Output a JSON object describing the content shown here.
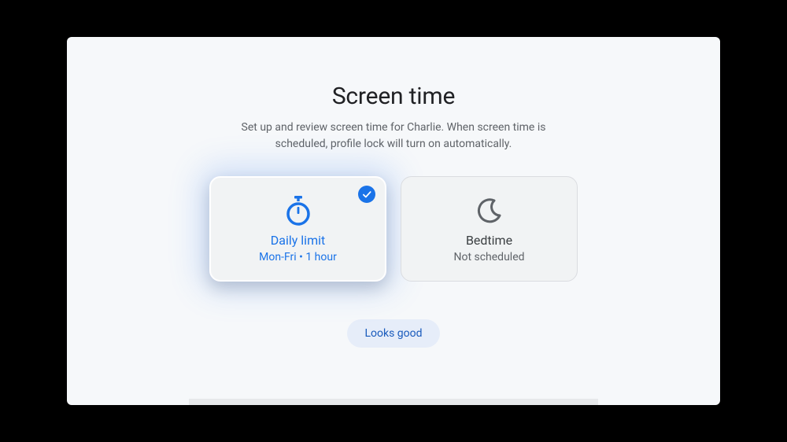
{
  "page": {
    "title": "Screen time",
    "subtitle": "Set up and review screen time for Charlie. When screen time is scheduled, profile lock will turn on automatically."
  },
  "cards": {
    "daily_limit": {
      "title": "Daily limit",
      "sub": "Mon-Fri • 1 hour",
      "selected": true
    },
    "bedtime": {
      "title": "Bedtime",
      "sub": "Not scheduled",
      "selected": false
    }
  },
  "actions": {
    "looks_good": "Looks good"
  },
  "colors": {
    "accent": "#1a73e8",
    "text_primary": "#202124",
    "text_secondary": "#5f6368",
    "button_bg": "#e6edf9",
    "button_text": "#185abc"
  }
}
